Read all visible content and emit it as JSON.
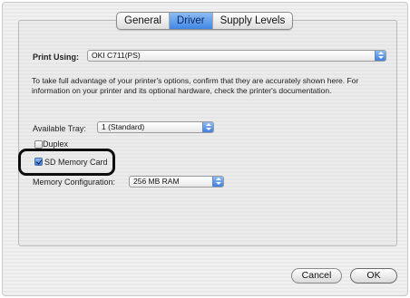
{
  "tabs": [
    {
      "label": "General",
      "active": false
    },
    {
      "label": "Driver",
      "active": true
    },
    {
      "label": "Supply Levels",
      "active": false
    }
  ],
  "print_using": {
    "label": "Print Using:",
    "value": "OKI C711(PS)"
  },
  "description": "To take full advantage of your printer's options, confirm that they are accurately shown here. For information on your printer and its optional hardware, check the printer's documentation.",
  "available_tray": {
    "label": "Available Tray:",
    "value": "1 (Standard)"
  },
  "duplex": {
    "label": "Duplex",
    "checked": false
  },
  "sd_card": {
    "label": "SD Memory Card",
    "checked": true
  },
  "memory": {
    "label": "Memory Configuration:",
    "value": "256 MB RAM"
  },
  "buttons": {
    "cancel": "Cancel",
    "ok": "OK"
  },
  "colors": {
    "accent": "#3f86e4",
    "highlight_outline": "#0d0d0d"
  }
}
